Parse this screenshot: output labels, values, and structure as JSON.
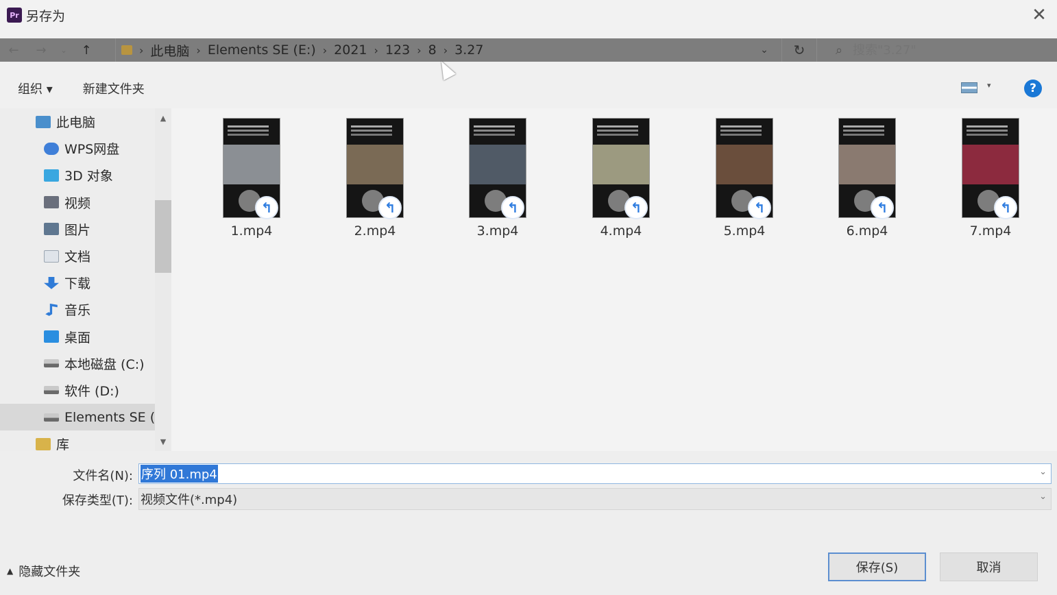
{
  "window": {
    "title": "另存为",
    "app_icon_text": "Pr"
  },
  "address": {
    "crumbs": [
      "此电脑",
      "Elements SE (E:)",
      "2021",
      "123",
      "8",
      "3.27"
    ],
    "search_placeholder": "搜索\"3.27\""
  },
  "toolbar": {
    "organize": "组织 ▾",
    "new_folder": "新建文件夹"
  },
  "sidebar": {
    "items": [
      {
        "label": "此电脑",
        "icon": "computer-icon"
      },
      {
        "label": "WPS网盘",
        "icon": "cloud-icon"
      },
      {
        "label": "3D 对象",
        "icon": "3d-objects-icon"
      },
      {
        "label": "视频",
        "icon": "video-icon"
      },
      {
        "label": "图片",
        "icon": "pictures-icon"
      },
      {
        "label": "文档",
        "icon": "documents-icon"
      },
      {
        "label": "下载",
        "icon": "download-icon"
      },
      {
        "label": "音乐",
        "icon": "music-icon"
      },
      {
        "label": "桌面",
        "icon": "desktop-icon"
      },
      {
        "label": "本地磁盘 (C:)",
        "icon": "drive-icon"
      },
      {
        "label": "软件 (D:)",
        "icon": "drive-icon"
      },
      {
        "label": "Elements SE (E",
        "icon": "drive-icon"
      },
      {
        "label": "库",
        "icon": "library-icon"
      }
    ]
  },
  "files": [
    {
      "name": "1.mp4",
      "scene_color": "#8b8f94"
    },
    {
      "name": "2.mp4",
      "scene_color": "#7a6a55"
    },
    {
      "name": "3.mp4",
      "scene_color": "#505a66"
    },
    {
      "name": "4.mp4",
      "scene_color": "#9c9a80"
    },
    {
      "name": "5.mp4",
      "scene_color": "#6a4e3c"
    },
    {
      "name": "6.mp4",
      "scene_color": "#8a7a70"
    },
    {
      "name": "7.mp4",
      "scene_color": "#8c2a3e"
    }
  ],
  "form": {
    "filename_label": "文件名(N):",
    "filename_value": "序列 01.mp4",
    "filetype_label": "保存类型(T):",
    "filetype_value": "视频文件(*.mp4)"
  },
  "footer": {
    "hide_folders": "隐藏文件夹",
    "save": "保存(S)",
    "cancel": "取消"
  },
  "colors": {
    "address_bar": "#7d7d7d",
    "selection": "#3078d7",
    "help": "#1a78d6"
  }
}
